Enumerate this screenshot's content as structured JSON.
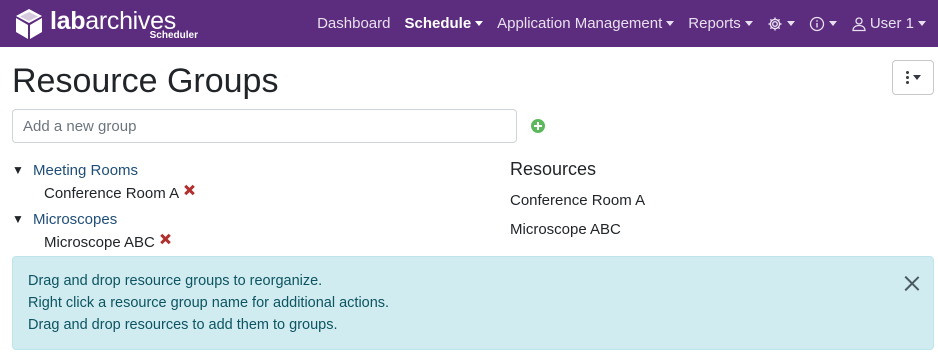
{
  "brand": {
    "logo_bold": "lab",
    "logo_rest": "archives",
    "subtitle": "Scheduler",
    "icon": "cube-logo-icon"
  },
  "nav": {
    "dashboard": "Dashboard",
    "schedule": "Schedule",
    "app_management": "Application Management",
    "reports": "Reports",
    "settings_icon": "gear-icon",
    "info_icon": "info-icon",
    "user_icon": "user-icon",
    "user": "User 1"
  },
  "page": {
    "title": "Resource Groups",
    "actions_icon": "kebab-menu-icon"
  },
  "add_group": {
    "placeholder": "Add a new group",
    "button_icon": "plus-circle-icon",
    "accent_color": "#5cb85c"
  },
  "groups": [
    {
      "name": "Meeting Rooms",
      "expanded": true,
      "items": [
        "Conference Room A"
      ]
    },
    {
      "name": "Microscopes",
      "expanded": true,
      "items": [
        "Microscope ABC"
      ]
    }
  ],
  "remove_icon": "remove-x-icon",
  "resources": {
    "heading": "Resources",
    "items": [
      "Conference Room A",
      "Microscope ABC"
    ]
  },
  "alert": {
    "lines": [
      "Drag and drop resource groups to reorganize.",
      "Right click a resource group name for additional actions.",
      "Drag and drop resources to add them to groups."
    ],
    "close_icon": "close-icon"
  },
  "colors": {
    "navbar": "#5c2c7e",
    "alert_bg": "#d1ecf1",
    "alert_text": "#0c5460",
    "remove": "#b03030",
    "group_link": "#1f4e79"
  }
}
